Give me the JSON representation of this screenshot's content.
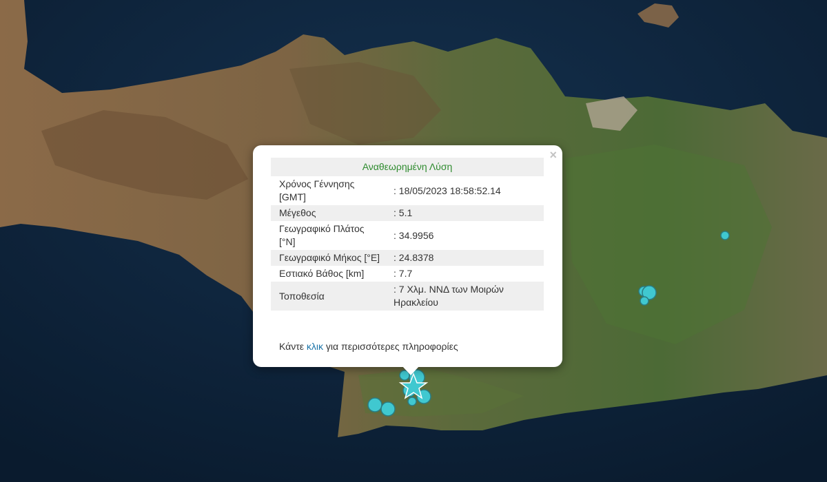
{
  "popup": {
    "title": "Αναθεωρημένη Λύση",
    "close_symbol": "×",
    "rows": [
      {
        "label": "Χρόνος Γέννησης [GMT]",
        "value": ": 18/05/2023 18:58:52.14"
      },
      {
        "label": "Μέγεθος",
        "value": ": 5.1"
      },
      {
        "label": "Γεωγραφικό Πλάτος [°N]",
        "value": ": 34.9956"
      },
      {
        "label": "Γεωγραφικό Μήκος [°E]",
        "value": ": 24.8378"
      },
      {
        "label": "Εστιακό Βάθος [km]",
        "value": ": 7.7"
      },
      {
        "label": "Τοποθεσία",
        "value": ": 7 Χλμ. ΝΝΔ των Μοιρών Ηρακλείου"
      }
    ],
    "more_prefix": "Κάντε ",
    "more_link": "κλικ",
    "more_suffix": " για περισσότερες πληροφορίες"
  },
  "markers": {
    "fill_color": "#40c8d0",
    "epicenter_icon": "star-icon"
  },
  "colors": {
    "sea": "#0d2238",
    "land": "#8a6a48",
    "vegetation": "#4a6a34"
  }
}
